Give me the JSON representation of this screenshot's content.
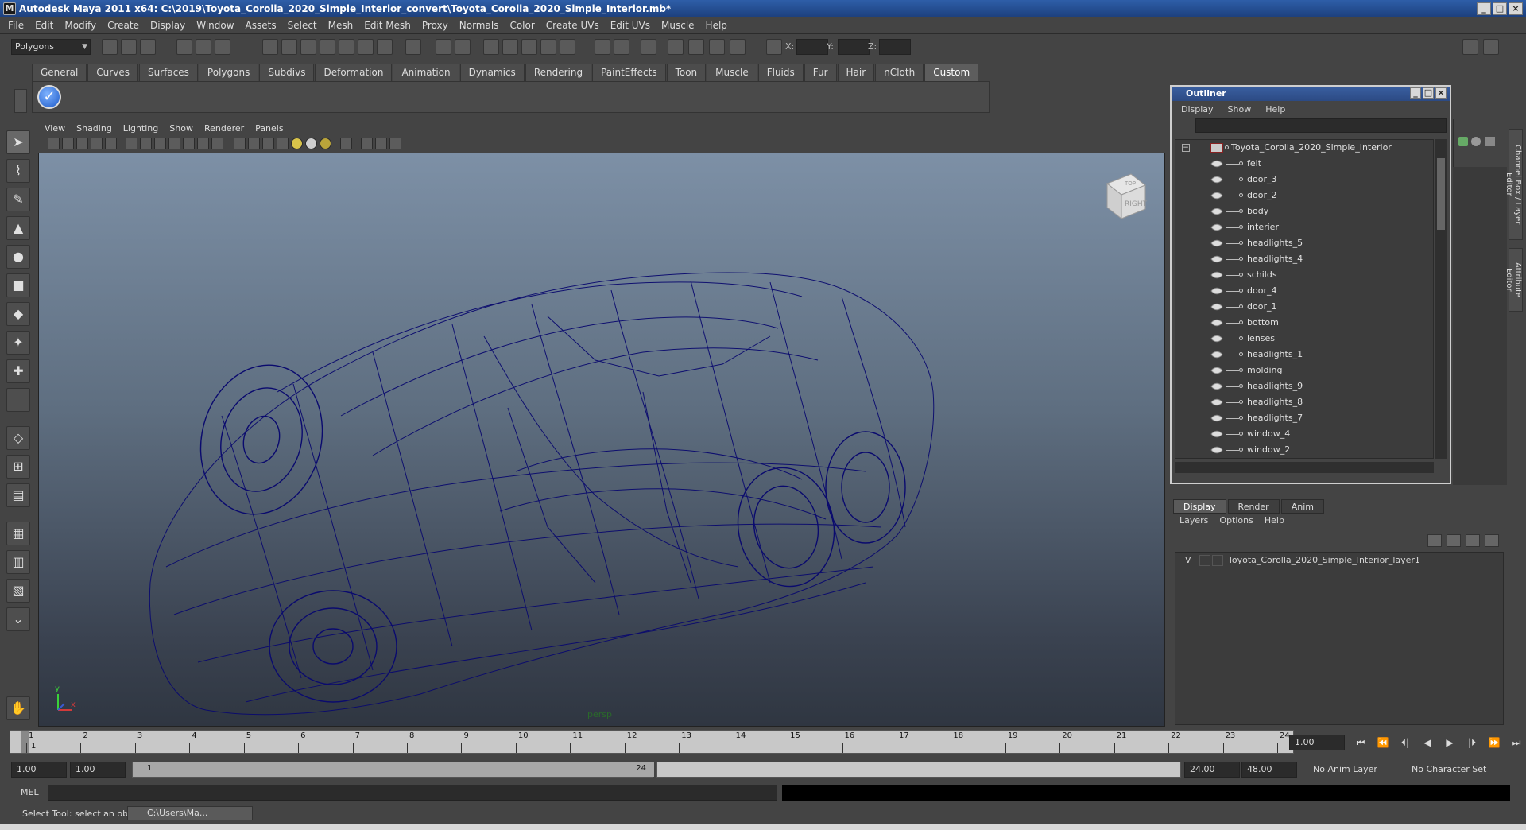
{
  "window": {
    "title": "Autodesk Maya 2011 x64: C:\\2019\\Toyota_Corolla_2020_Simple_Interior_convert\\Toyota_Corolla_2020_Simple_Interior.mb*",
    "buttons": [
      "_",
      "□",
      "×"
    ]
  },
  "menubar": [
    "File",
    "Edit",
    "Modify",
    "Create",
    "Display",
    "Window",
    "Assets",
    "Select",
    "Mesh",
    "Edit Mesh",
    "Proxy",
    "Normals",
    "Color",
    "Create UVs",
    "Edit UVs",
    "Muscle",
    "Help"
  ],
  "statusline": {
    "mode": "Polygons",
    "x_label": "X:",
    "y_label": "Y:",
    "z_label": "Z:"
  },
  "shelf": {
    "tabs": [
      "General",
      "Curves",
      "Surfaces",
      "Polygons",
      "Subdivs",
      "Deformation",
      "Animation",
      "Dynamics",
      "Rendering",
      "PaintEffects",
      "Toon",
      "Muscle",
      "Fluids",
      "Fur",
      "Hair",
      "nCloth",
      "Custom"
    ],
    "active_tab": "Custom"
  },
  "viewport": {
    "menu": [
      "View",
      "Shading",
      "Lighting",
      "Show",
      "Renderer",
      "Panels"
    ],
    "camera": "persp",
    "viewcube_face": "RIGHT",
    "viewcube_top": "TOP",
    "axis_y": "y",
    "axis_x": "x",
    "wire_color": "#0a0a6e"
  },
  "outliner": {
    "title": "Outliner",
    "menu": [
      "Display",
      "Show",
      "Help"
    ],
    "root": "Toyota_Corolla_2020_Simple_Interior",
    "items": [
      "felt",
      "door_3",
      "door_2",
      "body",
      "interier",
      "headlights_5",
      "headlights_4",
      "schilds",
      "door_4",
      "door_1",
      "bottom",
      "lenses",
      "headlights_1",
      "molding",
      "headlights_9",
      "headlights_8",
      "headlights_7",
      "window_4",
      "window_2"
    ]
  },
  "right_tabs": [
    "Channel Box / Layer Editor",
    "Attribute Editor"
  ],
  "layers": {
    "tabs": [
      "Display",
      "Render",
      "Anim"
    ],
    "active_tab": "Display",
    "menu": [
      "Layers",
      "Options",
      "Help"
    ],
    "rows": [
      {
        "visible": "V",
        "name": "Toyota_Corolla_2020_Simple_Interior_layer1"
      }
    ]
  },
  "timeslider": {
    "ticks": [
      "1",
      "2",
      "3",
      "4",
      "5",
      "6",
      "7",
      "8",
      "9",
      "10",
      "11",
      "12",
      "13",
      "14",
      "15",
      "16",
      "17",
      "18",
      "19",
      "20",
      "21",
      "22",
      "23",
      "24"
    ],
    "current_frame": "1",
    "current_frame_field": "1.00",
    "playback_buttons": [
      "⏮",
      "⏪",
      "⏴|",
      "◀",
      "▶",
      "|⏵",
      "⏩",
      "⏭"
    ]
  },
  "range": {
    "start": "1.00",
    "playback_start": "1.00",
    "range_start_label": "1",
    "range_end_label": "24",
    "playback_end": "24.00",
    "end": "48.00",
    "anim_layer": "No Anim Layer",
    "character_set": "No Character Set"
  },
  "command": {
    "label": "MEL"
  },
  "helpline": {
    "text": "Select Tool: select an object",
    "task": "C:\\Users\\Ma..."
  }
}
